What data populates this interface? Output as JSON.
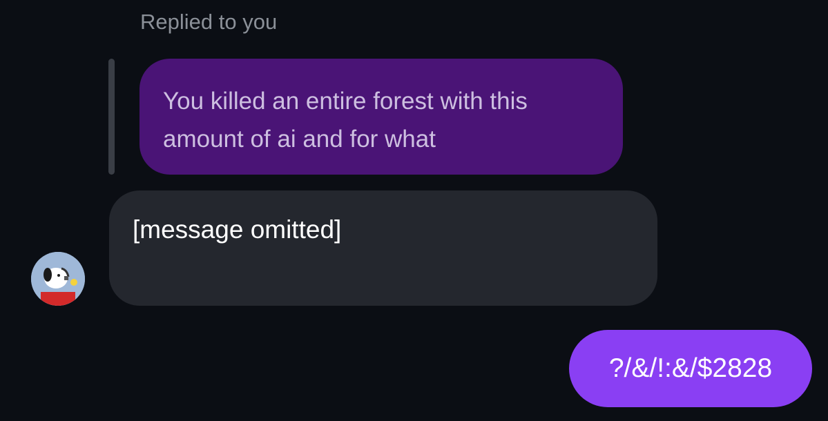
{
  "reply_context": {
    "label": "Replied to you"
  },
  "messages": [
    {
      "role": "quoted",
      "text": "You killed an entire forest with this amount of ai and for what"
    },
    {
      "role": "incoming",
      "text": "[message omitted]"
    },
    {
      "role": "outgoing",
      "text": "?/&/!:&/$2828"
    }
  ],
  "colors": {
    "background": "#0b0e14",
    "quoted_bubble": "#4a1476",
    "incoming_bubble": "#24272e",
    "outgoing_bubble": "#8a3ff3",
    "reply_bar": "#3a3e46"
  },
  "icons": {
    "avatar": "avatar-image"
  }
}
